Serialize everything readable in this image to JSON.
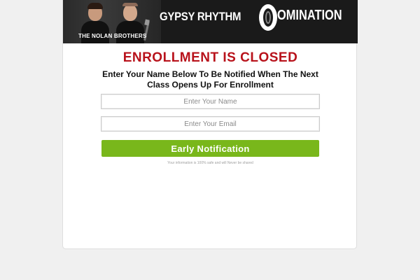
{
  "banner": {
    "brothers_label": "THE NOLAN BROTHERS",
    "title": "GYPSY RHYTHM",
    "title_suffix": "OMINATION",
    "logo_letter_icon": "stylized-D-icon"
  },
  "main": {
    "headline": "ENROLLMENT IS CLOSED",
    "subhead": "Enter Your Name Below To Be Notified When The Next Class Opens Up For Enrollment"
  },
  "form": {
    "name_placeholder": "Enter Your Name",
    "name_value": "",
    "email_placeholder": "Enter Your Email",
    "email_value": "",
    "submit_label": "Early Notification",
    "privacy_note": "Your information is 100% safe and will Never be shared"
  },
  "colors": {
    "headline": "#b8121b",
    "button": "#79b71b",
    "banner_bg": "#1a1a1a",
    "page_bg": "#f0f0f0"
  }
}
